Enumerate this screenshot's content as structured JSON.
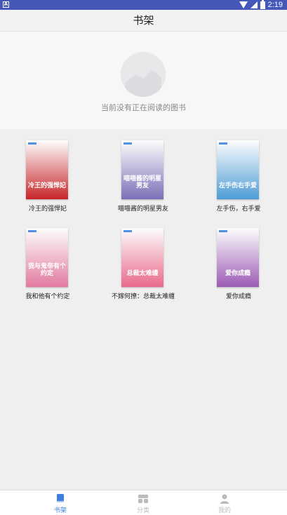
{
  "status_bar": {
    "time": "2:19",
    "app_badge": "A"
  },
  "header": {
    "title": "书架"
  },
  "empty_state": {
    "message": "当前没有正在阅读的图书"
  },
  "books": [
    {
      "title": "冷王的强悍妃",
      "cover_text": "冷王的强悍妃",
      "cover_bg": "#c8262a"
    },
    {
      "title": "喵喵酱的明星男友",
      "cover_text": "喵喵酱的明星男友",
      "cover_bg": "#7d6fb8"
    },
    {
      "title": "左手伤，右手爱",
      "cover_text": "左手伤右手爱",
      "cover_bg": "#4f9dd6"
    },
    {
      "title": "我和他有个约定",
      "cover_text": "我与鬼帝有个约定",
      "cover_bg": "#e27aa0"
    },
    {
      "title": "不嫁何撩：总裁太难缠",
      "cover_text": "总裁太难缠",
      "cover_bg": "#e96a8b"
    },
    {
      "title": "爱你成瘾",
      "cover_text": "爱你成瘾",
      "cover_bg": "#9c5bb5"
    }
  ],
  "bottom_nav": {
    "items": [
      {
        "label": "书架",
        "icon": "bookshelf-icon",
        "active": true
      },
      {
        "label": "分类",
        "icon": "category-icon",
        "active": false
      },
      {
        "label": "我的",
        "icon": "profile-icon",
        "active": false
      }
    ],
    "active_color": "#3e7fe0",
    "inactive_color": "#bbbbbb"
  },
  "colors": {
    "status_bar": "#4557b8",
    "accent": "#3e7fe0"
  }
}
